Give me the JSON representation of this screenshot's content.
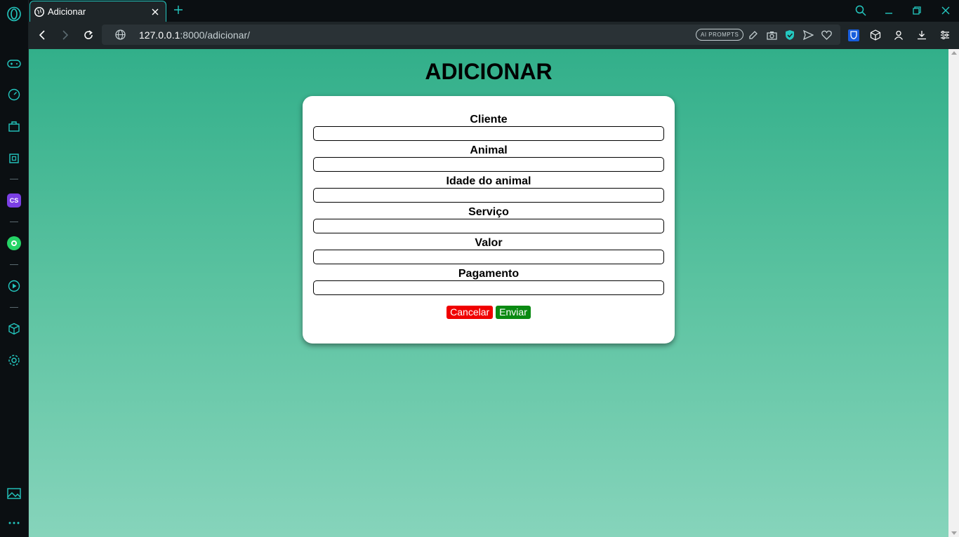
{
  "browser": {
    "tab": {
      "title": "Adicionar"
    },
    "url": {
      "host": "127.0.0.1",
      "rest": ":8000/adicionar/"
    },
    "ai_prompts_label": "AI PROMPTS"
  },
  "sidebar": {
    "icons": [
      "gamepad-icon",
      "speedometer-icon",
      "bag-icon",
      "chip-icon",
      "cs-app-icon",
      "whatsapp-icon",
      "player-icon",
      "cube-icon",
      "settings-icon",
      "gallery-icon",
      "more-icon"
    ]
  },
  "page": {
    "heading": "ADICIONAR",
    "fields": [
      {
        "label": "Cliente",
        "value": ""
      },
      {
        "label": "Animal",
        "value": ""
      },
      {
        "label": "Idade do animal",
        "value": ""
      },
      {
        "label": "Serviço",
        "value": ""
      },
      {
        "label": "Valor",
        "value": ""
      },
      {
        "label": "Pagamento",
        "value": ""
      }
    ],
    "buttons": {
      "cancel": "Cancelar",
      "send": "Enviar"
    }
  },
  "colors": {
    "accent": "#24c8c0",
    "background_top": "#32af8a",
    "background_bottom": "#86d4bb",
    "cancel_button": "#f00000",
    "send_button": "#0a8a12"
  }
}
